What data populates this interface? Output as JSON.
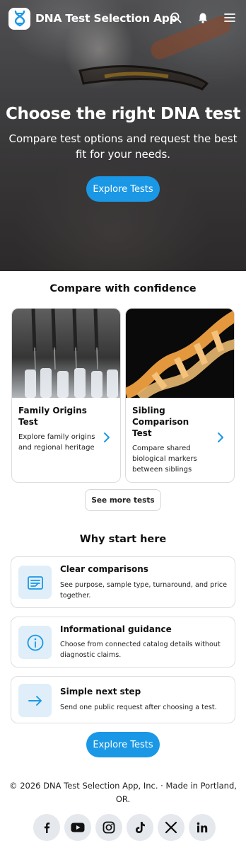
{
  "header": {
    "app_title": "DNA Test Selection App",
    "icons": [
      "dna-logo-icon",
      "search-icon",
      "notification-bell-icon",
      "menu-icon"
    ]
  },
  "hero": {
    "title": "Choose the right DNA test",
    "subtitle": "Compare test options and request the best fit for your needs.",
    "cta_label": "Explore Tests"
  },
  "compare": {
    "title": "Compare with confidence",
    "cards": [
      {
        "title": "Family Origins Test",
        "description": "Explore family origins and regional heritage"
      },
      {
        "title": "Sibling Comparison Test",
        "description": "Compare shared biological markers between siblings"
      }
    ],
    "see_more_label": "See more tests"
  },
  "why": {
    "title": "Why start here",
    "features": [
      {
        "title": "Clear comparisons",
        "description": "See purpose, sample type, turnaround, and price together.",
        "icon": "comparison-list-icon"
      },
      {
        "title": "Informational guidance",
        "description": "Choose from connected catalog details without diagnostic claims.",
        "icon": "info-icon"
      },
      {
        "title": "Simple next step",
        "description": "Send one public request after choosing a test.",
        "icon": "arrow-right-icon"
      }
    ],
    "cta_label": "Explore Tests"
  },
  "footer": {
    "copyright": "© 2026 DNA Test Selection App, Inc. · Made in Portland, OR.",
    "socials": [
      "facebook-icon",
      "youtube-icon",
      "instagram-icon",
      "tiktok-icon",
      "x-icon",
      "linkedin-icon"
    ]
  },
  "colors": {
    "accent": "#1a98e6",
    "icon_bg": "#dfeef8",
    "social_bg": "#e5e8ec"
  }
}
